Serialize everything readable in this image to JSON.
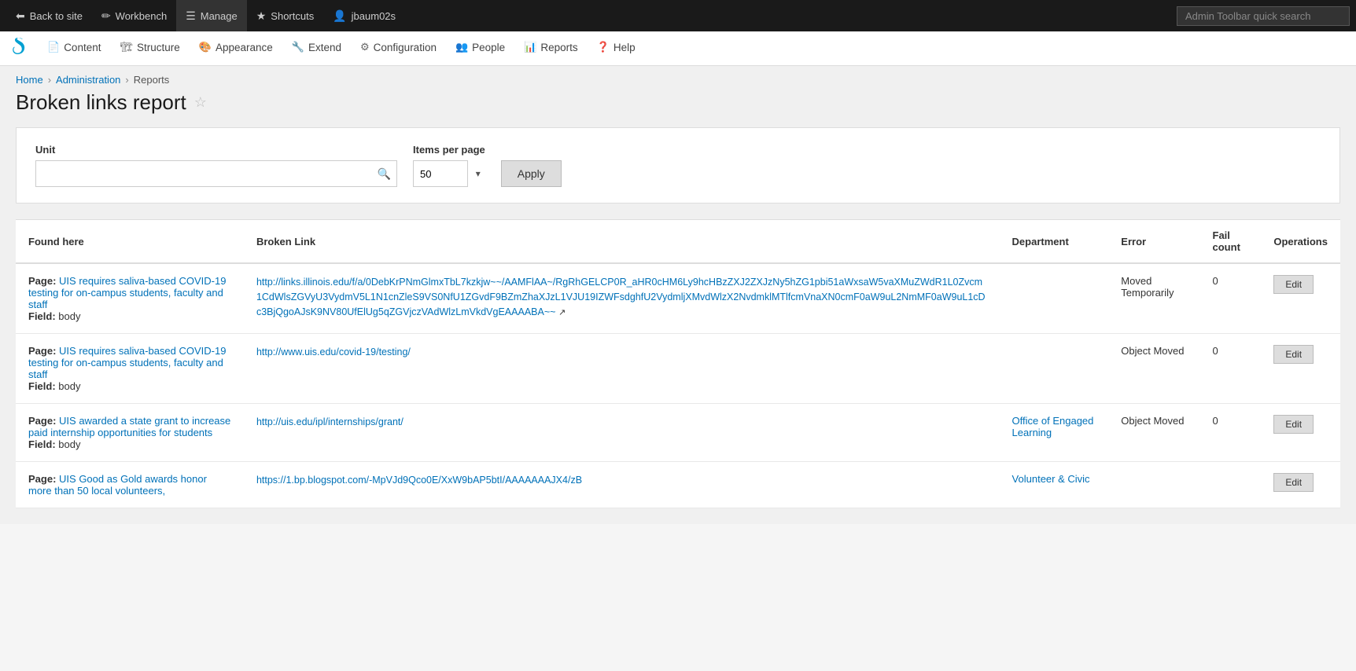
{
  "toolbar": {
    "back_to_site": "Back to site",
    "workbench": "Workbench",
    "manage": "Manage",
    "shortcuts": "Shortcuts",
    "user": "jbaum02s",
    "search_placeholder": "Admin Toolbar quick search"
  },
  "nav": {
    "items": [
      {
        "label": "Content",
        "icon": "📄"
      },
      {
        "label": "Structure",
        "icon": "🏗"
      },
      {
        "label": "Appearance",
        "icon": "🎨"
      },
      {
        "label": "Extend",
        "icon": "🔧"
      },
      {
        "label": "Configuration",
        "icon": "⚙"
      },
      {
        "label": "People",
        "icon": "👥"
      },
      {
        "label": "Reports",
        "icon": "📊"
      },
      {
        "label": "Help",
        "icon": "❓"
      }
    ]
  },
  "breadcrumb": {
    "items": [
      "Home",
      "Administration",
      "Reports"
    ]
  },
  "page": {
    "title": "Broken links report"
  },
  "filter": {
    "unit_label": "Unit",
    "unit_placeholder": "",
    "items_per_page_label": "Items per page",
    "items_per_page_value": "50",
    "apply_label": "Apply"
  },
  "table": {
    "columns": [
      "Found here",
      "Broken Link",
      "Department",
      "Error",
      "Fail count",
      "Operations"
    ],
    "rows": [
      {
        "found_here_prefix": "Page:",
        "found_here_link": "UIS requires saliva-based COVID-19 testing for on-campus students, faculty and staff",
        "found_here_link_href": "#",
        "field": "body",
        "broken_link": "http://links.illinois.edu/f/a/0DebKrPNmGlmxTbL7kzkjw~~/AAMFlAA~/RgRhGELCP0R_aHR0cHM6Ly9hcHBzZXJ2ZXJzNy5hZG1pbi51aWxsaW5vaXMuZWdR1L0Zvcm1CdWlsZGVyU3VydmV5L1N1cnZleS9VS0NfU1ZGvdF9BZmZhaXJzL1VJU19IZWFsdghfU2VydmljXMvdWlzX2NvdmklMTlfcmVnaXN0cmF0aW9uL2NmMF0aW9uL1cDc3BjQgoAJsK9NV80UfElUg5qZGVjazVAdWlzLmVkdVgEAAAABA~~☍",
        "department": "",
        "error": "Moved Temporarily",
        "fail_count": "0",
        "operation": "Edit"
      },
      {
        "found_here_prefix": "Page:",
        "found_here_link": "UIS requires saliva-based COVID-19 testing for on-campus students, faculty and staff",
        "found_here_link_href": "#",
        "field": "body",
        "broken_link": "http://www.uis.edu/covid-19/testing/",
        "department": "",
        "error": "Object Moved",
        "fail_count": "0",
        "operation": "Edit"
      },
      {
        "found_here_prefix": "Page:",
        "found_here_link": "UIS awarded a state grant to increase paid internship opportunities for students",
        "found_here_link_href": "#",
        "field": "body",
        "broken_link": "http://uis.edu/ipl/internships/grant/",
        "department": "Office of Engaged Learning",
        "department_href": "#",
        "error": "Object Moved",
        "fail_count": "0",
        "operation": "Edit"
      },
      {
        "found_here_prefix": "Page:",
        "found_here_link": "UIS Good as Gold awards honor more than 50 local volunteers,",
        "found_here_link_href": "#",
        "field": "",
        "broken_link": "https://1.bp.blogspot.com/-MpVJd9Qco0E/XxW9bAP5btI/AAAAAAAJX4/zB",
        "department": "Volunteer & Civic",
        "department_href": "#",
        "error": "",
        "fail_count": "",
        "operation": "Edit"
      }
    ]
  }
}
